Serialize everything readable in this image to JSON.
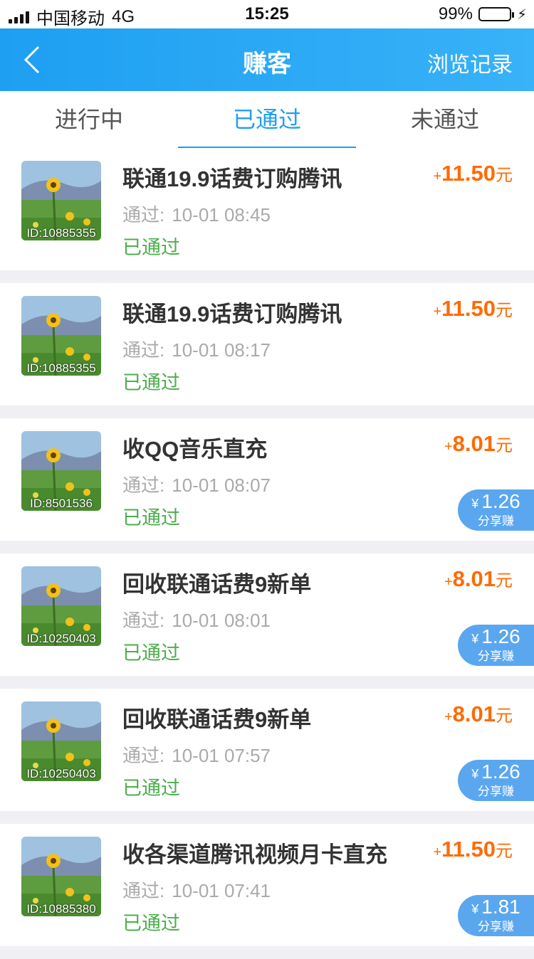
{
  "status_bar": {
    "carrier": "中国移动",
    "network": "4G",
    "time": "15:25",
    "battery": "99%"
  },
  "nav": {
    "title": "赚客",
    "right_label": "浏览记录"
  },
  "tabs": [
    {
      "label": "进行中"
    },
    {
      "label": "已通过"
    },
    {
      "label": "未通过"
    }
  ],
  "items": [
    {
      "id": "ID:10885355",
      "title": "联通19.9话费订购腾讯",
      "time_label": "通过:",
      "time": "10-01 08:45",
      "status": "已通过",
      "plus": "+",
      "amount": "11.50",
      "unit": "元"
    },
    {
      "id": "ID:10885355",
      "title": "联通19.9话费订购腾讯",
      "time_label": "通过:",
      "time": "10-01 08:17",
      "status": "已通过",
      "plus": "+",
      "amount": "11.50",
      "unit": "元"
    },
    {
      "id": "ID:8501536",
      "title": "收QQ音乐直充",
      "time_label": "通过:",
      "time": "10-01 08:07",
      "status": "已通过",
      "plus": "+",
      "amount": "8.01",
      "unit": "元",
      "share_currency": "¥",
      "share_value": "1.26",
      "share_label": "分享赚"
    },
    {
      "id": "ID:10250403",
      "title": "回收联通话费9新单",
      "time_label": "通过:",
      "time": "10-01 08:01",
      "status": "已通过",
      "plus": "+",
      "amount": "8.01",
      "unit": "元",
      "share_currency": "¥",
      "share_value": "1.26",
      "share_label": "分享赚"
    },
    {
      "id": "ID:10250403",
      "title": "回收联通话费9新单",
      "time_label": "通过:",
      "time": "10-01 07:57",
      "status": "已通过",
      "plus": "+",
      "amount": "8.01",
      "unit": "元",
      "share_currency": "¥",
      "share_value": "1.26",
      "share_label": "分享赚"
    },
    {
      "id": "ID:10885380",
      "title": "收各渠道腾讯视频月卡直充",
      "time_label": "通过:",
      "time": "10-01 07:41",
      "status": "已通过",
      "plus": "+",
      "amount": "11.50",
      "unit": "元",
      "share_currency": "¥",
      "share_value": "1.81",
      "share_label": "分享赚"
    }
  ],
  "colors": {
    "nav_blue": "#1e9ff2",
    "amount_orange": "#ff6a00",
    "status_green": "#4cae4c",
    "share_blue": "#5aa7f0"
  }
}
